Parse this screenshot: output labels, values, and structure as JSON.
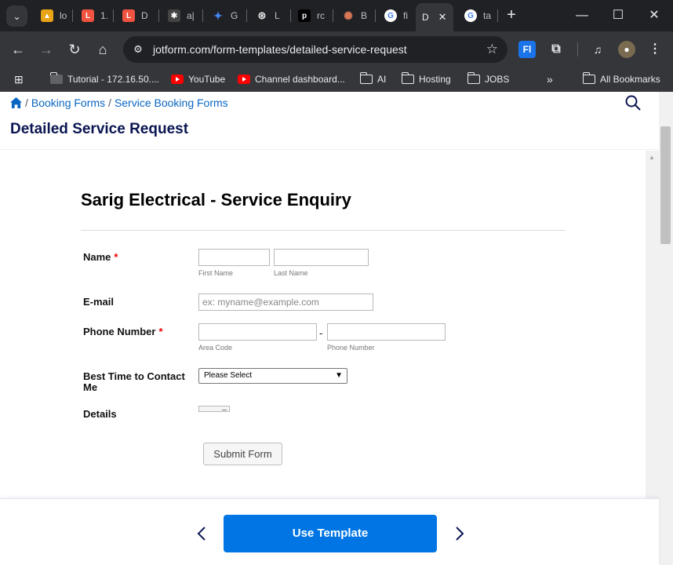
{
  "browser": {
    "tabs": [
      {
        "label": "lo",
        "favicon": "ruby-icon",
        "color": "#e8a317"
      },
      {
        "label": "1.",
        "favicon": "laravel-icon",
        "color": "#f05340"
      },
      {
        "label": "D",
        "favicon": "laravel-icon",
        "color": "#f05340"
      },
      {
        "label": "a|",
        "favicon": "ant-icon",
        "color": "#444"
      },
      {
        "label": "G",
        "favicon": "gemini-icon",
        "color": "#4285f4"
      },
      {
        "label": "L",
        "favicon": "openai-icon",
        "color": "#ddd"
      },
      {
        "label": "rc",
        "favicon": "p-icon",
        "color": "#000"
      },
      {
        "label": "B",
        "favicon": "claude-icon",
        "color": "#d97757"
      },
      {
        "label": "fi",
        "favicon": "google-icon",
        "color": "#fff"
      },
      {
        "label": "D",
        "favicon": "",
        "color": "",
        "active": true
      },
      {
        "label": "ta",
        "favicon": "google-icon",
        "color": "#fff"
      }
    ],
    "url": "jotform.com/form-templates/detailed-service-request",
    "bookmarks": [
      {
        "label": "Tutorial - 172.16.50....",
        "icon": "folder-dark-icon"
      },
      {
        "label": "YouTube",
        "icon": "youtube-icon"
      },
      {
        "label": "Channel dashboard...",
        "icon": "youtube-icon"
      },
      {
        "label": "AI",
        "icon": "folder-icon"
      },
      {
        "label": "Hosting",
        "icon": "folder-icon"
      },
      {
        "label": "JOBS",
        "icon": "folder-icon"
      },
      {
        "label": "All Bookmarks",
        "icon": "folder-icon"
      }
    ],
    "more_bookmarks": "»"
  },
  "page": {
    "breadcrumb": [
      "Booking Forms",
      "Service Booking Forms"
    ],
    "breadcrumb_sep": "/",
    "title": "Detailed Service Request",
    "use_template": "Use Template"
  },
  "form": {
    "title": "Sarig Electrical - Service Enquiry",
    "name_label": "Name",
    "required_mark": "*",
    "first_name_sub": "First Name",
    "last_name_sub": "Last Name",
    "email_label": "E-mail",
    "email_placeholder": "ex: myname@example.com",
    "phone_label": "Phone Number",
    "area_code_sub": "Area Code",
    "phone_number_sub": "Phone Number",
    "phone_dash": "-",
    "best_time_label": "Best Time to Contact Me",
    "best_time_selected": "Please Select",
    "details_label": "Details",
    "submit_label": "Submit Form"
  },
  "colors": {
    "accent": "#0075e3",
    "title": "#0a1551",
    "link": "#0a66c2",
    "required": "#ee0000"
  }
}
